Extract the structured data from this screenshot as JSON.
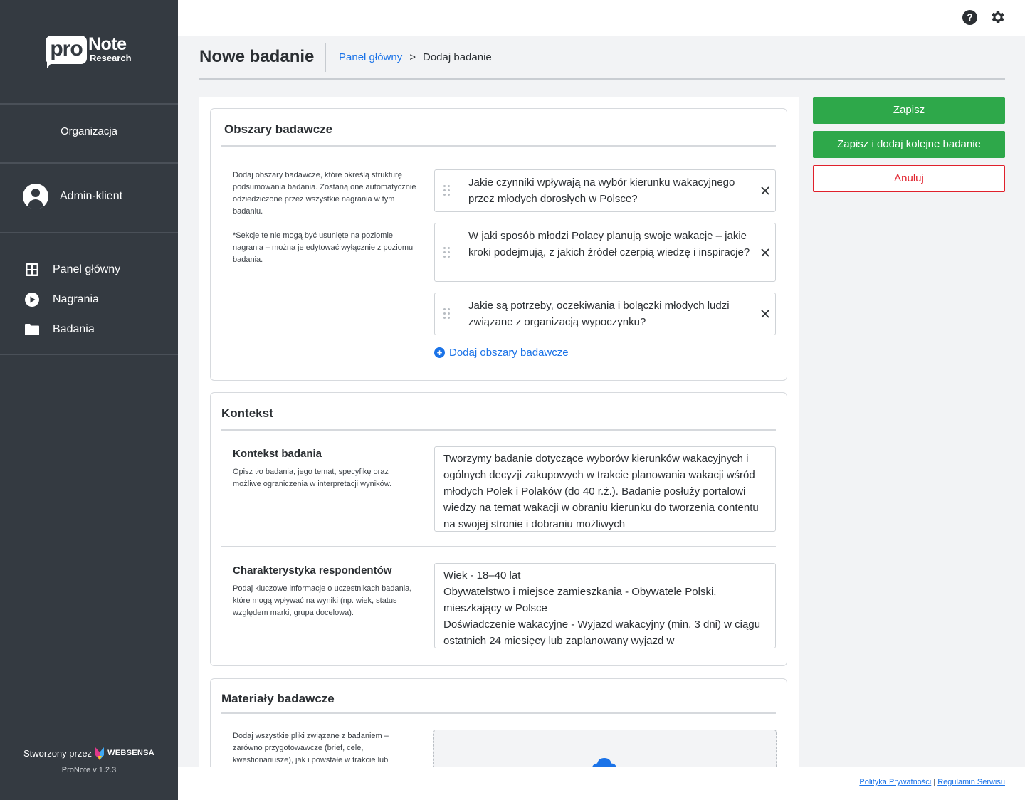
{
  "brand": {
    "logo_pro": "pro",
    "logo_note": "Note",
    "logo_research": "Research"
  },
  "sidebar": {
    "organization": "Organizacja",
    "user_name": "Admin-klient",
    "nav": [
      {
        "label": "Panel główny",
        "icon": "dashboard-icon"
      },
      {
        "label": "Nagrania",
        "icon": "play-icon"
      },
      {
        "label": "Badania",
        "icon": "folder-icon"
      }
    ],
    "credit_prefix": "Stworzony przez",
    "credit_brand": "WEBSENSA",
    "version": "ProNote v 1.2.3"
  },
  "topbar": {
    "help_glyph": "?"
  },
  "header": {
    "title": "Nowe badanie",
    "breadcrumb_link": "Panel główny",
    "breadcrumb_sep": ">",
    "breadcrumb_current": "Dodaj badanie"
  },
  "areas": {
    "title": "Obszary badawcze",
    "desc1": "Dodaj obszary badawcze, które określą strukturę podsumowania badania. Zostaną one automatycznie odziedziczone przez wszystkie nagrania w tym badaniu.",
    "desc2": "*Sekcje te nie mogą być usunięte na poziomie nagrania – można je edytować wyłącznie z poziomu badania.",
    "questions": [
      "Jakie czynniki wpływają na wybór kierunku wakacyjnego przez młodych dorosłych w Polsce?",
      "W jaki sposób młodzi Polacy planują swoje wakacje – jakie kroki podejmują, z jakich źródeł czerpią wiedzę i inspiracje?",
      "Jakie są potrzeby, oczekiwania i bolączki młodych ludzi związane z organizacją wypoczynku?"
    ],
    "add_label": "Dodaj obszary badawcze"
  },
  "context": {
    "title": "Kontekst",
    "context_heading": "Kontekst badania",
    "context_desc": "Opisz tło badania, jego temat, specyfikę oraz możliwe ograniczenia w interpretacji wyników.",
    "context_value": "Tworzymy badanie dotyczące wyborów kierunków wakacyjnych i ogólnych decyzji zakupowych w trakcie planowania wakacji wśród młodych Polek i Polaków (do 40 r.ż.). Badanie posłuży portalowi wiedzy na temat wakacji w obraniu kierunku do tworzenia contentu na swojej stronie i dobraniu możliwych",
    "resp_heading": "Charakterystyka respondentów",
    "resp_desc": "Podaj kluczowe informacje o uczestnikach badania, które mogą wpływać na wyniki (np. wiek, status względem marki, grupa docelowa).",
    "resp_value": "Wiek - 18–40 lat\nObywatelstwo i miejsce zamieszkania - Obywatele Polski, mieszkający w Polsce\nDoświadczenie wakacyjne - Wyjazd wakacyjny (min. 3 dni) w ciągu ostatnich 24 miesięcy lub zaplanowany wyjazd w"
  },
  "materials": {
    "title": "Materiały badawcze",
    "desc": "Dodaj wszystkie pliki związane z badaniem – zarówno przygotowawcze (brief, cele, kwestionariusze), jak i powstałe w trakcie lub"
  },
  "actions": {
    "save": "Zapisz",
    "save_add": "Zapisz i dodaj kolejne badanie",
    "cancel": "Anuluj"
  },
  "footer": {
    "privacy": "Polityka Prywatności",
    "divider": "|",
    "terms": "Regulamin Serwisu"
  },
  "colors": {
    "sidebar": "#343a41",
    "primary_green": "#2ea84a",
    "link_blue": "#1b73e8",
    "danger_red": "#e0202b"
  }
}
